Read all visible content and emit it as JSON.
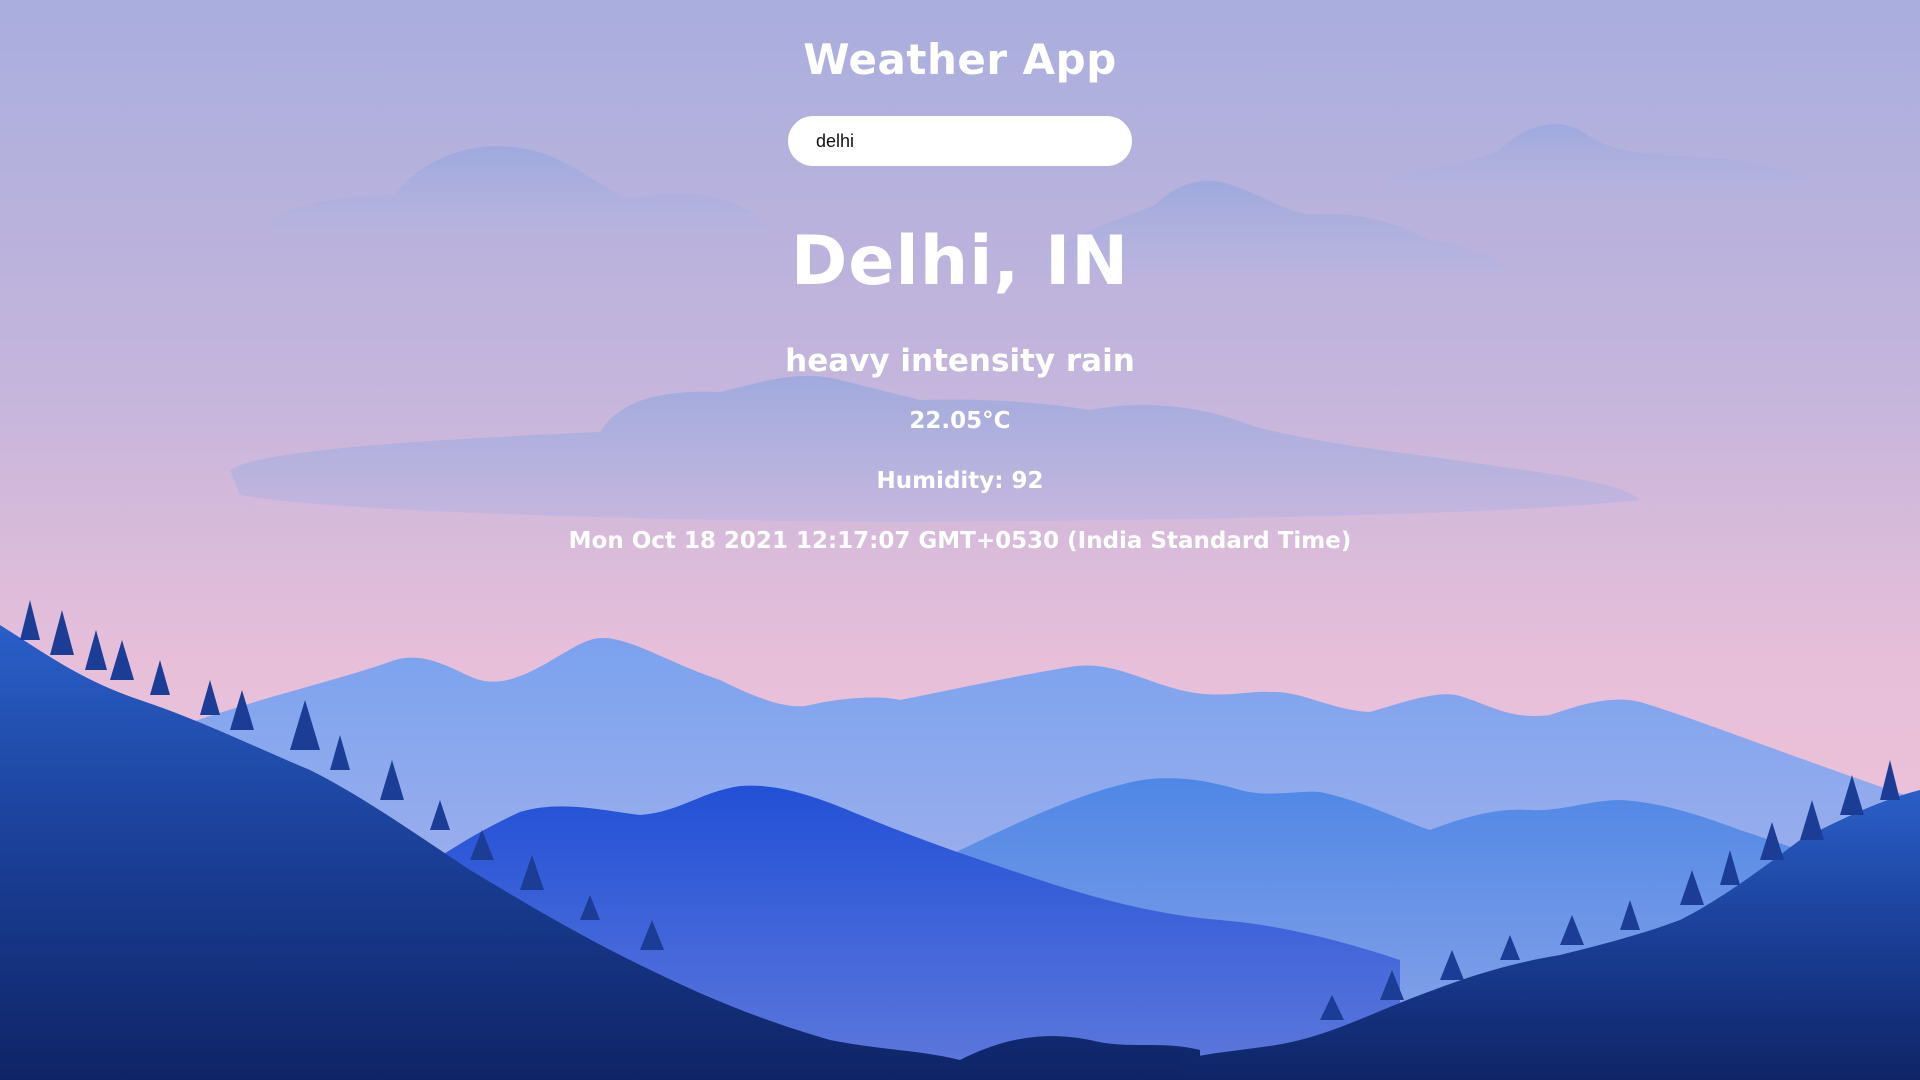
{
  "app": {
    "title": "Weather App"
  },
  "search": {
    "value": "delhi"
  },
  "weather": {
    "location": "Delhi, IN",
    "description": "heavy intensity rain",
    "temperature": "22.05°C",
    "humidity_label": "Humidity:",
    "humidity_value": "92",
    "datetime": "Mon Oct 18 2021 12:17:07 GMT+0530 (India Standard Time)"
  },
  "background": {
    "scene": "mountain-landscape-with-clouds",
    "sky_top": "#a9aede",
    "sky_bottom": "#f1c3d8",
    "mountain_far": "#7ea3ee",
    "mountain_mid": "#4f86e6",
    "mountain_near": "#2452c9",
    "hill_dark": "#152e77"
  }
}
